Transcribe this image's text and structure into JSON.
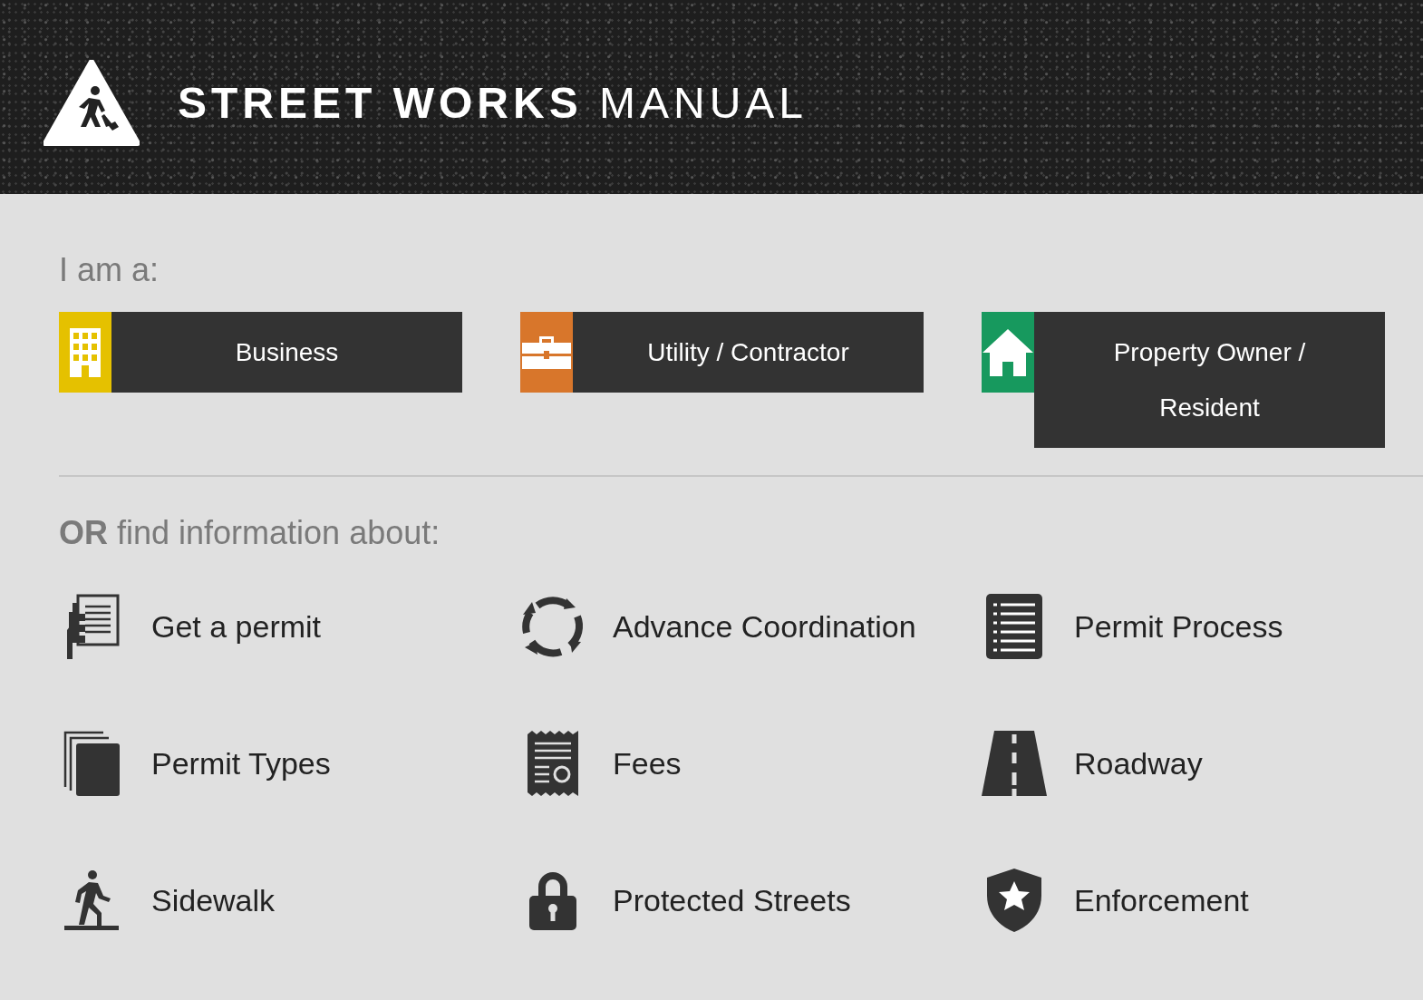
{
  "header": {
    "title": "**STREET WORKS** MANUAL"
  },
  "roles": {
    "heading": "I am a:",
    "items": [
      {
        "label": "Business",
        "color": "#e5c100"
      },
      {
        "label": "Utility / Contractor",
        "color": "#d8762b"
      },
      {
        "label": "Property Owner / Resident",
        "color": "#17995e"
      }
    ]
  },
  "topics": {
    "heading": "**OR** find information about:",
    "items": [
      {
        "label": "Get a permit"
      },
      {
        "label": "Advance Coordination"
      },
      {
        "label": "Permit Process"
      },
      {
        "label": "Permit Types"
      },
      {
        "label": "Fees"
      },
      {
        "label": "Roadway"
      },
      {
        "label": "Sidewalk"
      },
      {
        "label": "Protected Streets"
      },
      {
        "label": "Enforcement"
      }
    ]
  }
}
